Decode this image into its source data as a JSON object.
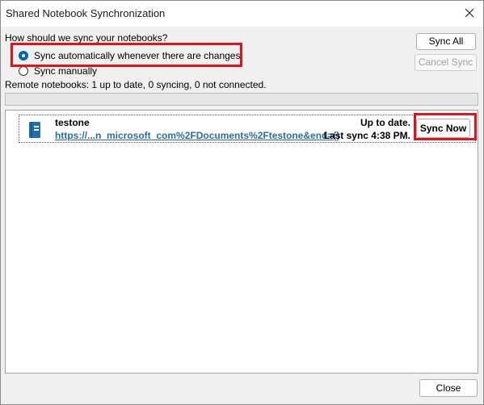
{
  "window": {
    "title": "Shared Notebook Synchronization"
  },
  "sync_options": {
    "question": "How should we sync your notebooks?",
    "auto_label": "Sync automatically whenever there are changes",
    "manual_label": "Sync manually",
    "selected": "auto"
  },
  "buttons": {
    "sync_all": "Sync All",
    "cancel_sync": "Cancel Sync",
    "close": "Close"
  },
  "remote_status": "Remote notebooks: 1 up to date, 0 syncing, 0 not connected.",
  "notebooks": [
    {
      "name": "testone",
      "url": "https://...n_microsoft_com%2FDocuments%2Ftestone&end=()",
      "status": "Up to date.",
      "last_sync": "Last sync 4:38 PM.",
      "sync_now_label": "Sync Now"
    }
  ],
  "colors": {
    "highlight": "#e3111d",
    "radio_selected": "#0067c0",
    "link": "#2e6c9e",
    "notebook_icon": "#1f6fb2"
  },
  "icons": {
    "close": "close-icon",
    "notebook": "notebook-icon"
  }
}
